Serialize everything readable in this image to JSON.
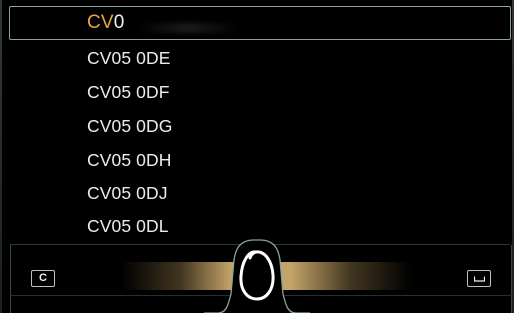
{
  "input": {
    "typed": "CV",
    "pending": "0"
  },
  "suggestions": [
    "CV05 0DE",
    "CV05 0DF",
    "CV05 0DG",
    "CV05 0DH",
    "CV05 0DJ",
    "CV05 0DL"
  ],
  "keys": {
    "clear_label": "C"
  },
  "colors": {
    "typed_text": "#e7a63b",
    "pending_text": "#f0f2f1",
    "frame_border": "#8aa59b",
    "glow": "#cdac6e"
  },
  "icons": {
    "space": "space-key-icon",
    "pad_stroke": "handwritten-o-stroke"
  }
}
